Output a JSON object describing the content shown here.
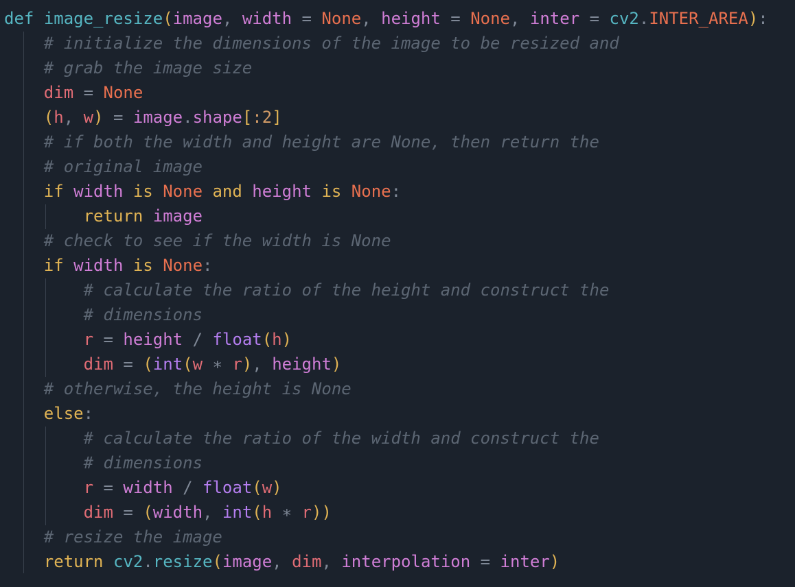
{
  "editor": {
    "language": "python",
    "theme_colors": {
      "background": "#1b222c",
      "keyword": "#e0b354",
      "function": "#56b6c2",
      "parameter": "#d07ed6",
      "variable": "#e06c75",
      "constant": "#e8704f",
      "builtin": "#b57ef0",
      "comment": "#5c6673",
      "operator": "#7f8896"
    },
    "lines": [
      [
        [
          "defkw",
          "def"
        ],
        [
          "plain",
          " "
        ],
        [
          "fn",
          "image_resize"
        ],
        [
          "paren",
          "("
        ],
        [
          "param",
          "image"
        ],
        [
          "op",
          ", "
        ],
        [
          "param",
          "width"
        ],
        [
          "op",
          " = "
        ],
        [
          "none",
          "None"
        ],
        [
          "op",
          ", "
        ],
        [
          "param",
          "height"
        ],
        [
          "op",
          " = "
        ],
        [
          "none",
          "None"
        ],
        [
          "op",
          ", "
        ],
        [
          "param",
          "inter"
        ],
        [
          "op",
          " = "
        ],
        [
          "fn",
          "cv2"
        ],
        [
          "op",
          "."
        ],
        [
          "none",
          "INTER_AREA"
        ],
        [
          "paren",
          ")"
        ],
        [
          "op",
          ":"
        ]
      ],
      [
        [
          "plain",
          "    "
        ],
        [
          "cmt",
          "# initialize the dimensions of the image to be resized and"
        ]
      ],
      [
        [
          "plain",
          "    "
        ],
        [
          "cmt",
          "# grab the image size"
        ]
      ],
      [
        [
          "plain",
          "    "
        ],
        [
          "var",
          "dim"
        ],
        [
          "op",
          " = "
        ],
        [
          "none",
          "None"
        ]
      ],
      [
        [
          "plain",
          "    "
        ],
        [
          "paren",
          "("
        ],
        [
          "var",
          "h"
        ],
        [
          "op",
          ", "
        ],
        [
          "var",
          "w"
        ],
        [
          "paren",
          ")"
        ],
        [
          "op",
          " = "
        ],
        [
          "param",
          "image"
        ],
        [
          "op",
          "."
        ],
        [
          "param",
          "shape"
        ],
        [
          "paren",
          "["
        ],
        [
          "num",
          ":2"
        ],
        [
          "paren",
          "]"
        ]
      ],
      [
        [
          "plain",
          "    "
        ],
        [
          "cmt",
          "# if both the width and height are None, then return the"
        ]
      ],
      [
        [
          "plain",
          "    "
        ],
        [
          "cmt",
          "# original image"
        ]
      ],
      [
        [
          "plain",
          "    "
        ],
        [
          "kw",
          "if"
        ],
        [
          "plain",
          " "
        ],
        [
          "param",
          "width"
        ],
        [
          "plain",
          " "
        ],
        [
          "kw",
          "is"
        ],
        [
          "plain",
          " "
        ],
        [
          "none",
          "None"
        ],
        [
          "plain",
          " "
        ],
        [
          "kw",
          "and"
        ],
        [
          "plain",
          " "
        ],
        [
          "param",
          "height"
        ],
        [
          "plain",
          " "
        ],
        [
          "kw",
          "is"
        ],
        [
          "plain",
          " "
        ],
        [
          "none",
          "None"
        ],
        [
          "op",
          ":"
        ]
      ],
      [
        [
          "plain",
          "        "
        ],
        [
          "kw",
          "return"
        ],
        [
          "plain",
          " "
        ],
        [
          "param",
          "image"
        ]
      ],
      [
        [
          "plain",
          "    "
        ],
        [
          "cmt",
          "# check to see if the width is None"
        ]
      ],
      [
        [
          "plain",
          "    "
        ],
        [
          "kw",
          "if"
        ],
        [
          "plain",
          " "
        ],
        [
          "param",
          "width"
        ],
        [
          "plain",
          " "
        ],
        [
          "kw",
          "is"
        ],
        [
          "plain",
          " "
        ],
        [
          "none",
          "None"
        ],
        [
          "op",
          ":"
        ]
      ],
      [
        [
          "plain",
          "        "
        ],
        [
          "cmt",
          "# calculate the ratio of the height and construct the"
        ]
      ],
      [
        [
          "plain",
          "        "
        ],
        [
          "cmt",
          "# dimensions"
        ]
      ],
      [
        [
          "plain",
          "        "
        ],
        [
          "var",
          "r"
        ],
        [
          "op",
          " = "
        ],
        [
          "param",
          "height"
        ],
        [
          "op",
          " / "
        ],
        [
          "builtin",
          "float"
        ],
        [
          "paren",
          "("
        ],
        [
          "var",
          "h"
        ],
        [
          "paren",
          ")"
        ]
      ],
      [
        [
          "plain",
          "        "
        ],
        [
          "var",
          "dim"
        ],
        [
          "op",
          " = "
        ],
        [
          "paren",
          "("
        ],
        [
          "builtin",
          "int"
        ],
        [
          "paren",
          "("
        ],
        [
          "var",
          "w"
        ],
        [
          "op",
          " ∗ "
        ],
        [
          "var",
          "r"
        ],
        [
          "paren",
          ")"
        ],
        [
          "op",
          ", "
        ],
        [
          "param",
          "height"
        ],
        [
          "paren",
          ")"
        ]
      ],
      [
        [
          "plain",
          "    "
        ],
        [
          "cmt",
          "# otherwise, the height is None"
        ]
      ],
      [
        [
          "plain",
          "    "
        ],
        [
          "kw",
          "else"
        ],
        [
          "op",
          ":"
        ]
      ],
      [
        [
          "plain",
          "        "
        ],
        [
          "cmt",
          "# calculate the ratio of the width and construct the"
        ]
      ],
      [
        [
          "plain",
          "        "
        ],
        [
          "cmt",
          "# dimensions"
        ]
      ],
      [
        [
          "plain",
          "        "
        ],
        [
          "var",
          "r"
        ],
        [
          "op",
          " = "
        ],
        [
          "param",
          "width"
        ],
        [
          "op",
          " / "
        ],
        [
          "builtin",
          "float"
        ],
        [
          "paren",
          "("
        ],
        [
          "var",
          "w"
        ],
        [
          "paren",
          ")"
        ]
      ],
      [
        [
          "plain",
          "        "
        ],
        [
          "var",
          "dim"
        ],
        [
          "op",
          " = "
        ],
        [
          "paren",
          "("
        ],
        [
          "param",
          "width"
        ],
        [
          "op",
          ", "
        ],
        [
          "builtin",
          "int"
        ],
        [
          "paren",
          "("
        ],
        [
          "var",
          "h"
        ],
        [
          "op",
          " ∗ "
        ],
        [
          "var",
          "r"
        ],
        [
          "paren",
          "))"
        ]
      ],
      [
        [
          "plain",
          "    "
        ],
        [
          "cmt",
          "# resize the image"
        ]
      ],
      [
        [
          "plain",
          "    "
        ],
        [
          "kw",
          "return"
        ],
        [
          "plain",
          " "
        ],
        [
          "fn",
          "cv2"
        ],
        [
          "op",
          "."
        ],
        [
          "fn",
          "resize"
        ],
        [
          "paren",
          "("
        ],
        [
          "param",
          "image"
        ],
        [
          "op",
          ", "
        ],
        [
          "var",
          "dim"
        ],
        [
          "op",
          ", "
        ],
        [
          "param",
          "interpolation"
        ],
        [
          "op",
          " = "
        ],
        [
          "param",
          "inter"
        ],
        [
          "paren",
          ")"
        ]
      ]
    ]
  }
}
